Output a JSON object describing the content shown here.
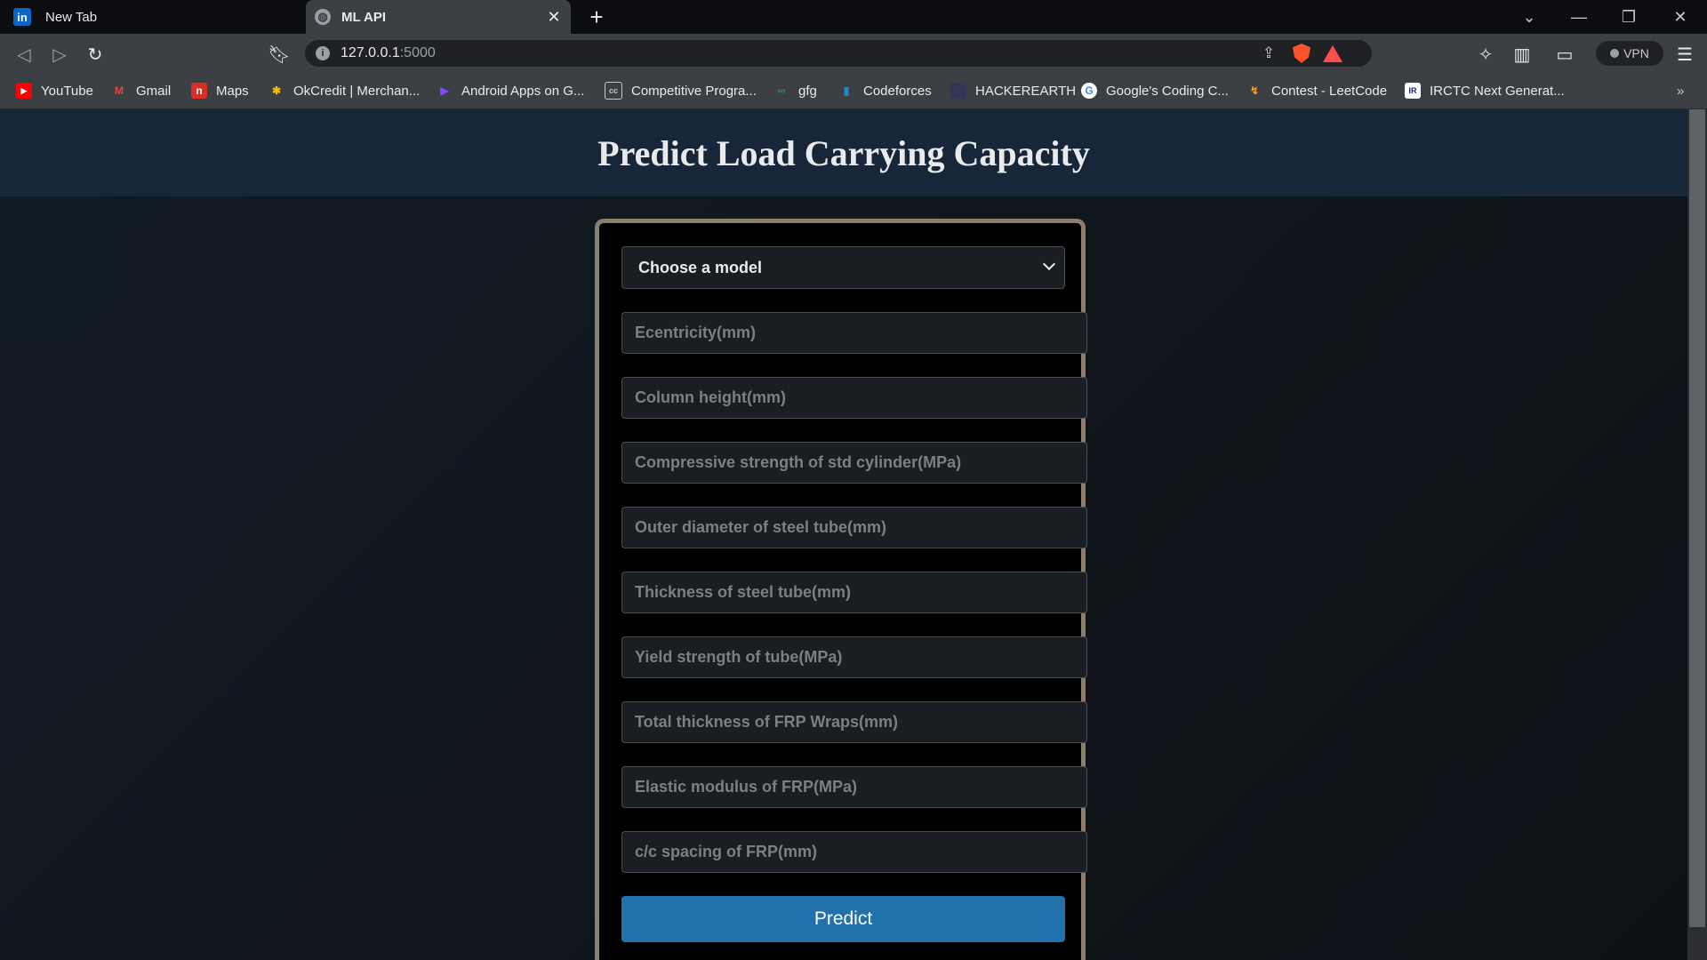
{
  "tabs": [
    {
      "title": "New Tab",
      "icon": "linkedin-icon"
    },
    {
      "title": "ML API",
      "icon": "globe-icon",
      "active": true
    }
  ],
  "toolbar": {
    "url_host": "127.0.0.1",
    "url_port": ":5000",
    "vpn_label": "VPN"
  },
  "bookmarks": [
    {
      "label": "YouTube",
      "icon": "youtube-icon",
      "color": "#ff0000"
    },
    {
      "label": "Gmail",
      "icon": "gmail-icon",
      "color": "#ea4335"
    },
    {
      "label": "Maps",
      "icon": "maps-icon",
      "color": "#d93025"
    },
    {
      "label": "OkCredit | Merchan...",
      "icon": "okcredit-icon",
      "color": "#fbbc04"
    },
    {
      "label": "Android Apps on G...",
      "icon": "google-play-icon",
      "color": "#7c4dff"
    },
    {
      "label": "Competitive Progra...",
      "icon": "codechef-icon",
      "color": "#c8c8c8"
    },
    {
      "label": "gfg",
      "icon": "gfg-icon",
      "color": "#2f8d46"
    },
    {
      "label": "Codeforces",
      "icon": "codeforces-icon",
      "color": "#1f8acb"
    },
    {
      "label": "HACKEREARTH",
      "icon": "hackerearth-icon",
      "color": "#323754"
    },
    {
      "label": "Google's Coding C...",
      "icon": "google-icon",
      "color": "#ffffff"
    },
    {
      "label": "Contest - LeetCode",
      "icon": "leetcode-icon",
      "color": "#ffa116"
    },
    {
      "label": "IRCTC Next Generat...",
      "icon": "irctc-icon",
      "color": "#ffffff"
    }
  ],
  "page": {
    "title": "Predict Load Carrying Capacity",
    "model_select": "Choose a model",
    "fields": [
      "Ecentricity(mm)",
      "Column height(mm)",
      "Compressive strength of std cylinder(MPa)",
      "Outer diameter of steel tube(mm)",
      "Thickness of steel tube(mm)",
      "Yield strength of tube(MPa)",
      "Total thickness of FRP Wraps(mm)",
      "Elastic modulus of FRP(MPa)",
      "c/c spacing of FRP(mm)"
    ],
    "predict_label": "Predict"
  }
}
